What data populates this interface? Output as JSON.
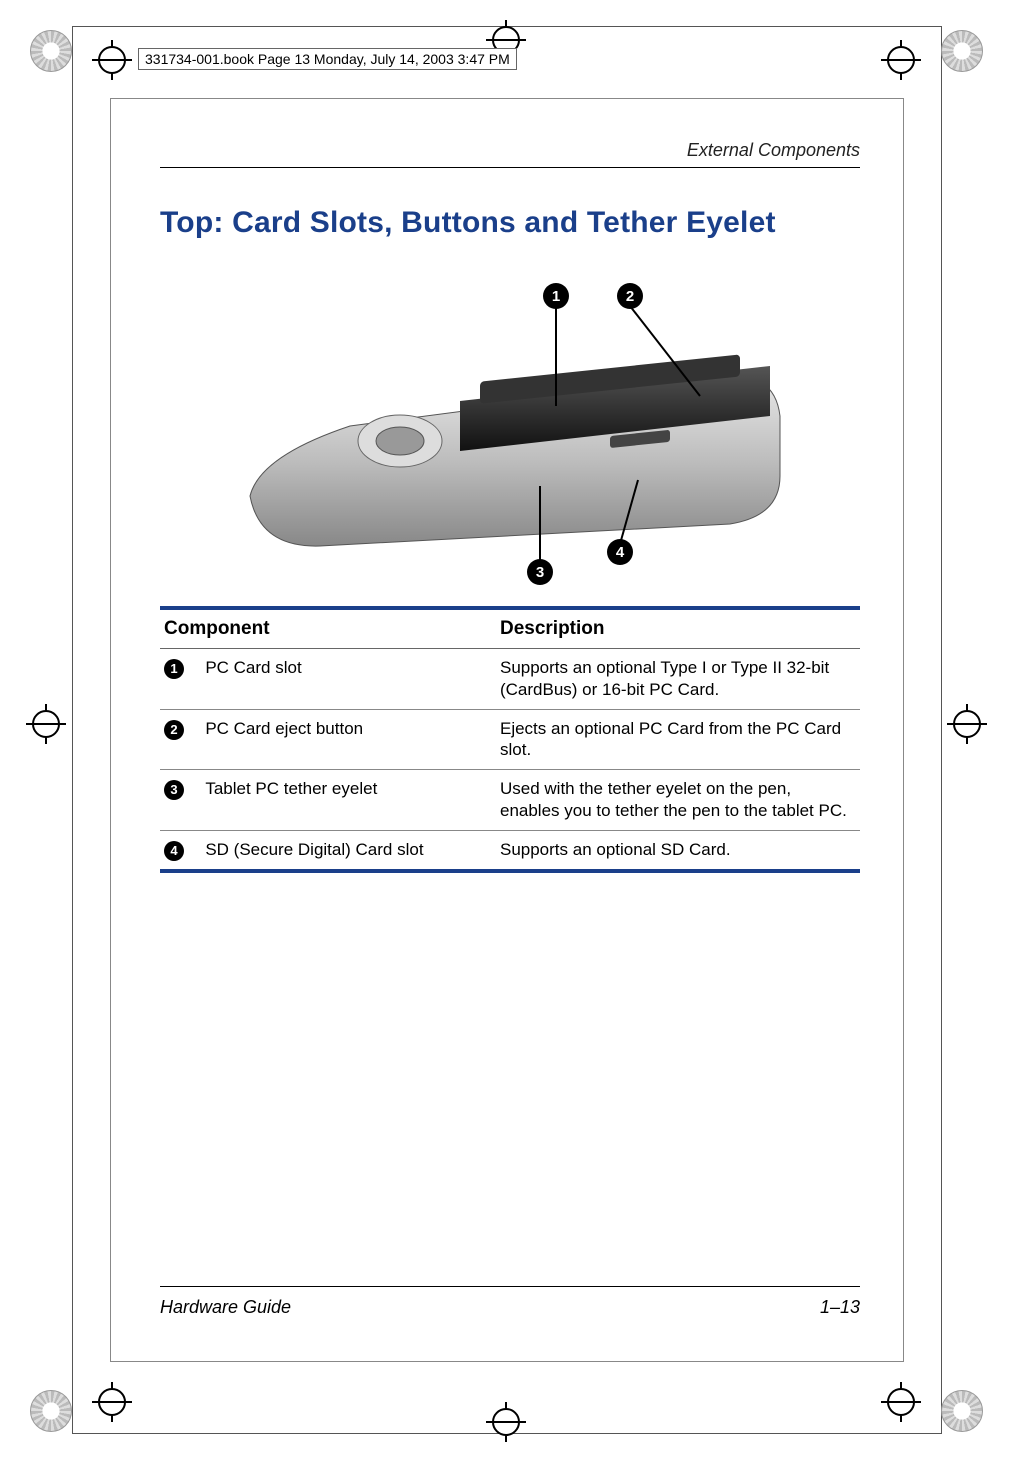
{
  "printers_mark_label": "331734-001.book  Page 13  Monday, July 14, 2003  3:47 PM",
  "running_head": "External Components",
  "section_title": "Top: Card Slots, Buttons and Tether Eyelet",
  "figure": {
    "alt": "Line art of the top edge of a tablet PC showing four numbered callouts pointing to a PC Card slot, PC Card eject button, tether eyelet, and SD Card slot.",
    "callouts": [
      "1",
      "2",
      "3",
      "4"
    ]
  },
  "table": {
    "headers": {
      "component": "Component",
      "description": "Description"
    },
    "rows": [
      {
        "num": "1",
        "component": "PC Card slot",
        "description": "Supports an optional Type I or Type II 32-bit (CardBus) or 16-bit PC Card."
      },
      {
        "num": "2",
        "component": "PC Card eject button",
        "description": "Ejects an optional PC Card from the PC Card slot."
      },
      {
        "num": "3",
        "component": "Tablet PC tether eyelet",
        "description": "Used with the tether eyelet on the pen, enables you to tether the pen to the tablet PC."
      },
      {
        "num": "4",
        "component": "SD (Secure Digital) Card slot",
        "description": "Supports an optional SD Card."
      }
    ]
  },
  "footer": {
    "guide": "Hardware Guide",
    "page": "1–13"
  }
}
